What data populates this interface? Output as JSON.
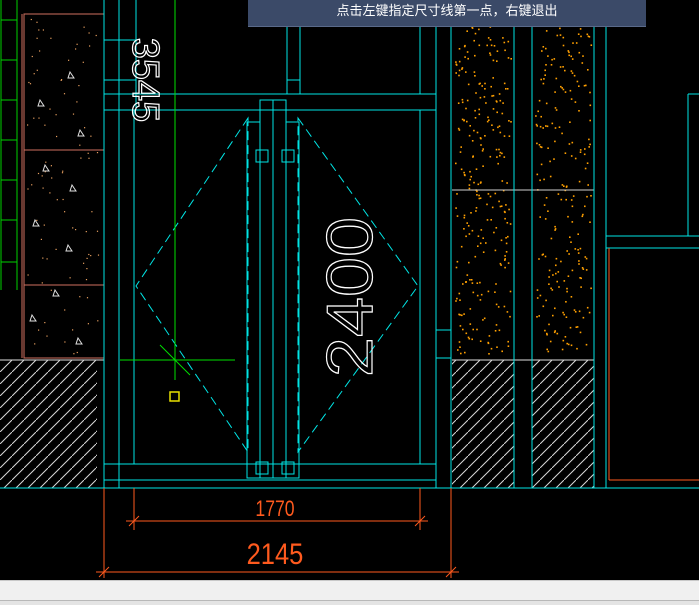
{
  "prompt": {
    "text": "点击左键指定尺寸线第一点，右键退出"
  },
  "drawing": {
    "dimensions": [
      {
        "id": "dim-door-inner-width",
        "value": "1770"
      },
      {
        "id": "dim-overall-width",
        "value": "2145"
      },
      {
        "id": "dim-door-height",
        "value": "2400"
      },
      {
        "id": "dim-top-left",
        "value": "3545"
      }
    ],
    "colors": {
      "background": "#000000",
      "frame": "#00e5e5",
      "dimension": "#ff5a1e",
      "stone_dots": "#ffa000",
      "crosshair": "#00e000",
      "text_white": "#ffffff",
      "osnap_marker": "#e8e000",
      "prompt_bg": "#3b4a68"
    }
  },
  "statusbar": {
    "text": ""
  }
}
